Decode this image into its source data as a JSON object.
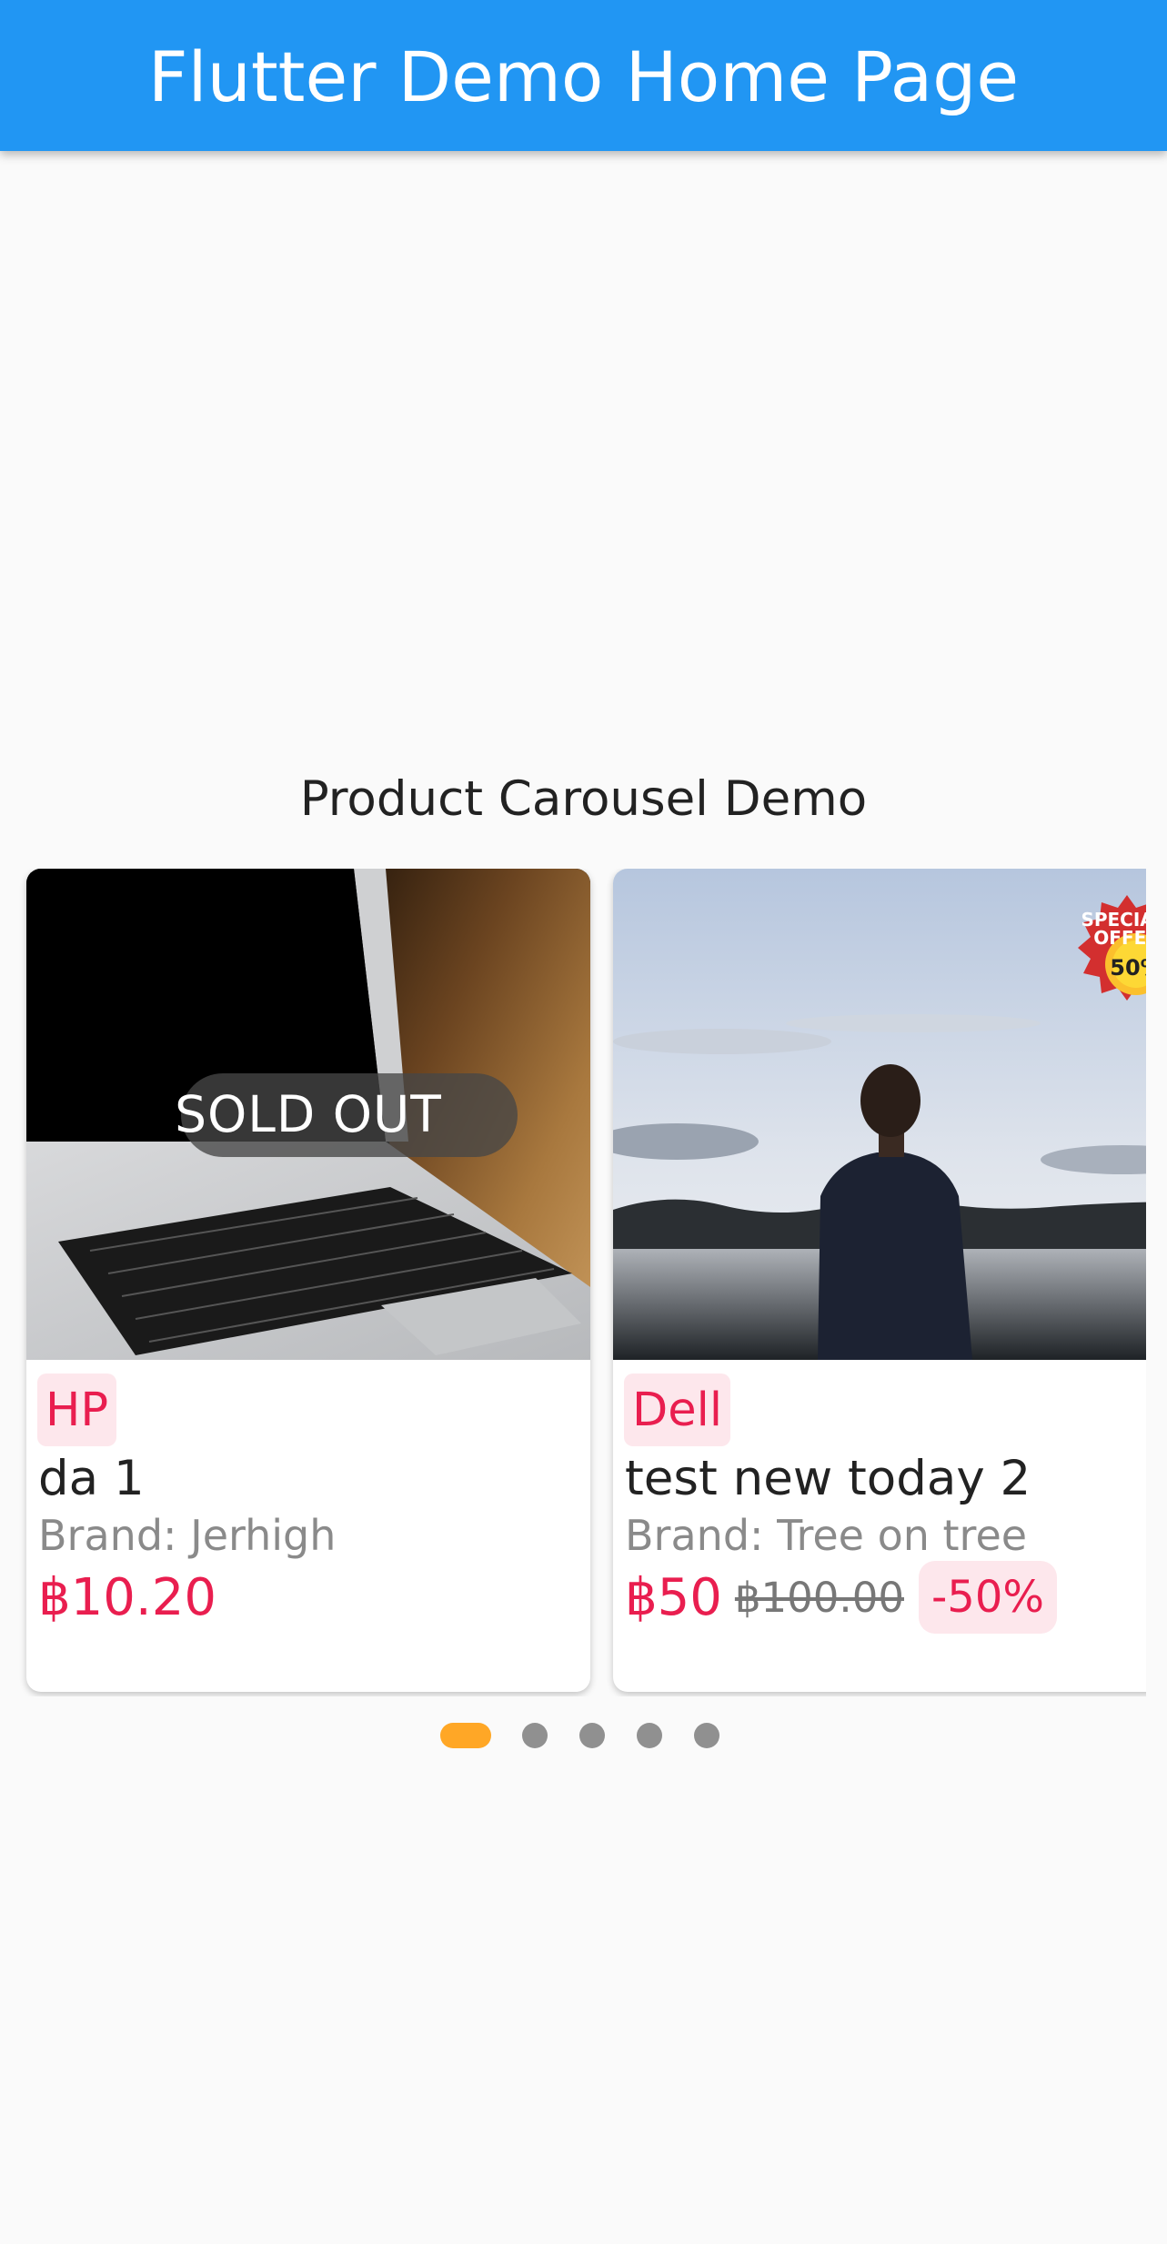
{
  "app_bar": {
    "title": "Flutter Demo Home Page",
    "color": "#2196f3"
  },
  "section": {
    "title": "Product Carousel Demo"
  },
  "products": [
    {
      "image": "laptop-photo",
      "overlay_label": "SOLD OUT",
      "brand_tag": "HP",
      "name": "da 1",
      "brand_line": "Brand: Jerhigh",
      "price": "฿10.20"
    },
    {
      "image": "man-at-lake-photo",
      "badge_icon": "special-offer-badge-icon",
      "brand_tag": "Dell",
      "name": "test new today 2",
      "brand_line": "Brand: Tree on tree",
      "price": "฿50",
      "original_price": "฿100.00",
      "discount": "-50%"
    }
  ],
  "pagination": {
    "total": 5,
    "active_index": 0,
    "active_color": "#ffa726",
    "inactive_color": "#909090"
  },
  "colors": {
    "accent": "#e91e4f",
    "background": "#fafafa"
  }
}
